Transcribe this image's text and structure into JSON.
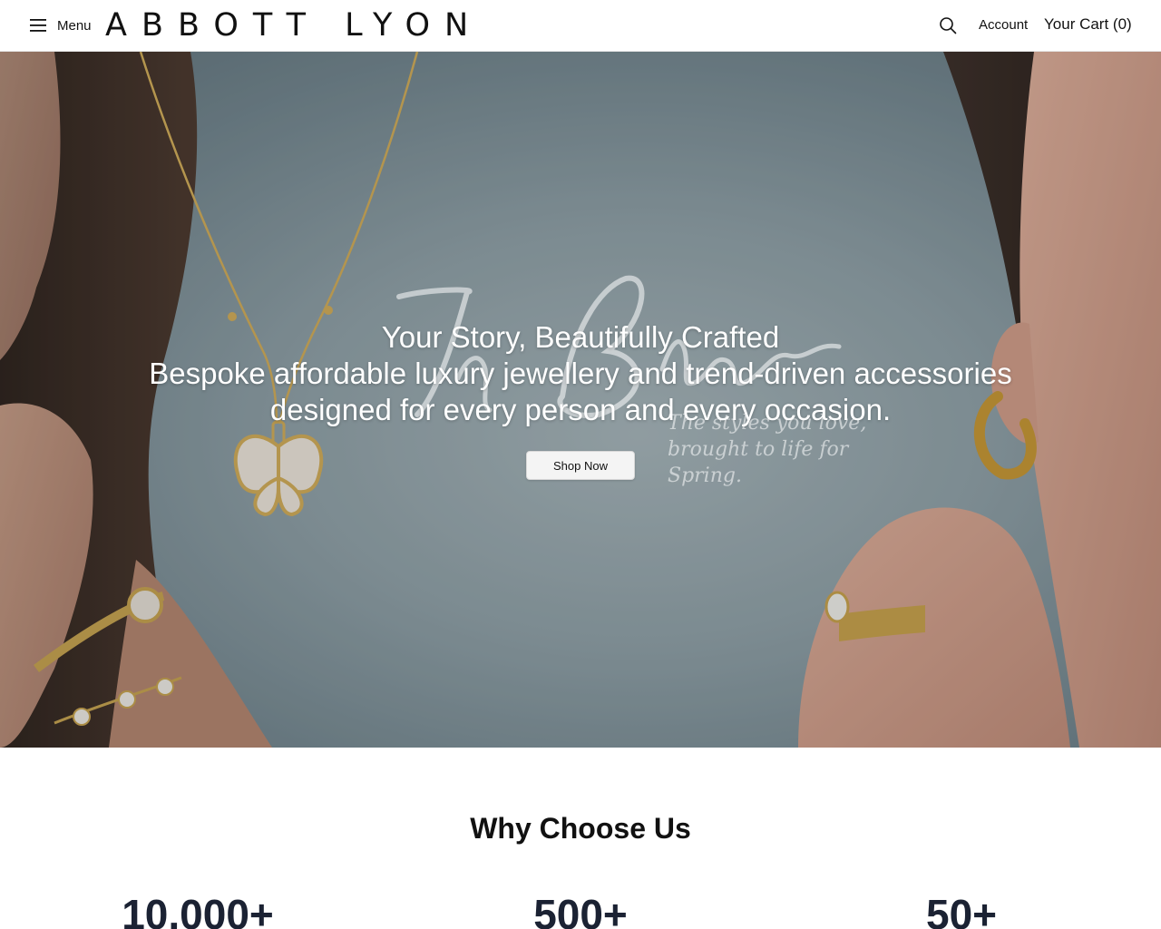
{
  "header": {
    "menu_label": "Menu",
    "logo_text": "ABBOTT LYON",
    "account_label": "Account",
    "cart_label": "Your Cart (0)"
  },
  "hero": {
    "title": "Your Story, Beautifully Crafted",
    "subtitle": "Bespoke affordable luxury jewellery and trend-driven accessories designed for every person and every occasion.",
    "script_heading": "In Bloom",
    "script_tagline": "The styles you love, brought to life for Spring.",
    "cta_label": "Shop Now"
  },
  "why": {
    "title": "Why Choose Us",
    "stats": [
      {
        "value": "10,000+"
      },
      {
        "value": "500+"
      },
      {
        "value": "50+"
      }
    ]
  },
  "icons": {
    "menu": "hamburger-icon",
    "search": "search-icon"
  }
}
